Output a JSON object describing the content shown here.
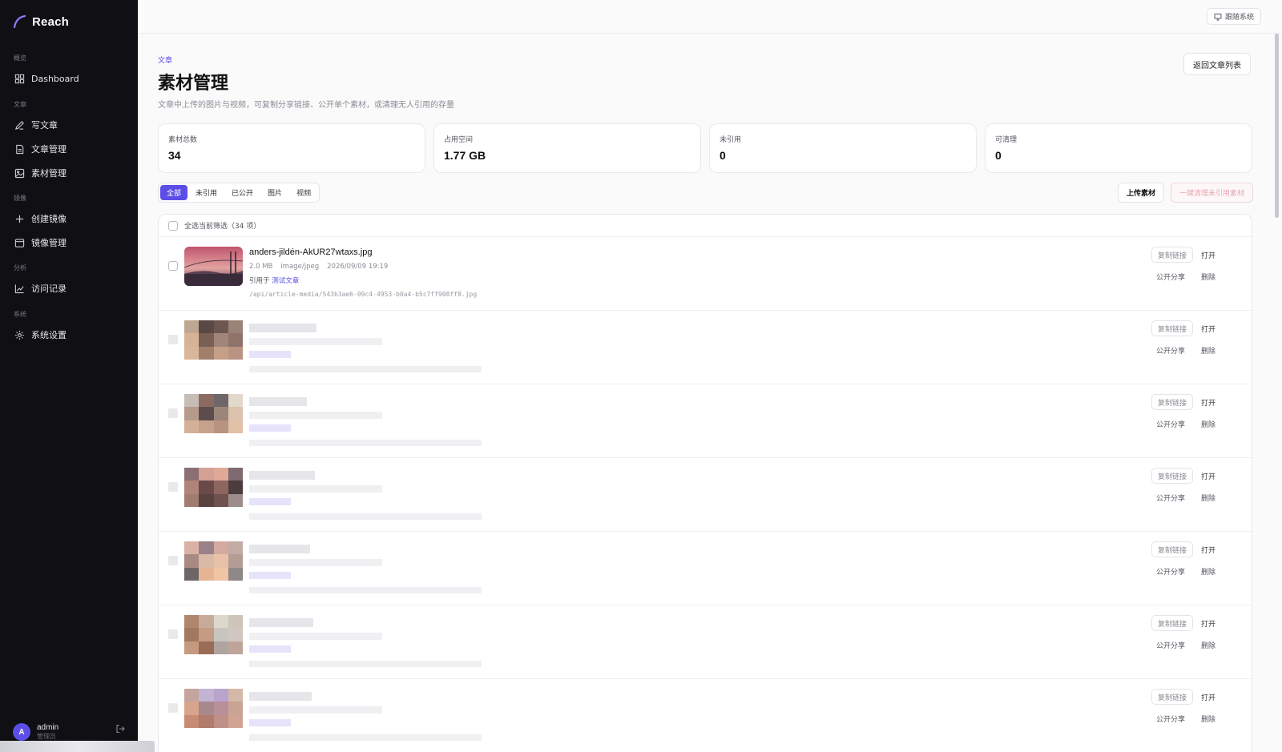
{
  "app": {
    "brand": "Reach"
  },
  "sidebar": {
    "groups": [
      {
        "label": "概览",
        "items": [
          {
            "label": "Dashboard",
            "icon": "grid-icon"
          }
        ]
      },
      {
        "label": "文章",
        "items": [
          {
            "label": "写文章",
            "icon": "pen-icon"
          },
          {
            "label": "文章管理",
            "icon": "document-icon"
          },
          {
            "label": "素材管理",
            "icon": "image-icon"
          }
        ]
      },
      {
        "label": "镜像",
        "items": [
          {
            "label": "创建镜像",
            "icon": "plus-icon"
          },
          {
            "label": "镜像管理",
            "icon": "window-icon"
          }
        ]
      },
      {
        "label": "分析",
        "items": [
          {
            "label": "访问记录",
            "icon": "line-chart-icon"
          }
        ]
      },
      {
        "label": "系统",
        "items": [
          {
            "label": "系统设置",
            "icon": "gear-icon"
          }
        ]
      }
    ],
    "user": {
      "initial": "A",
      "name": "admin",
      "role": "管理员"
    }
  },
  "topbar": {
    "follow_label": "跟随系统"
  },
  "header": {
    "crumb": "文章",
    "title": "素材管理",
    "subtitle": "文章中上传的图片与视频，可复制分享链接、公开单个素材，或清理无人引用的存量",
    "back_label": "返回文章列表"
  },
  "stats": [
    {
      "label": "素材总数",
      "value": "34"
    },
    {
      "label": "占用空间",
      "value": "1.77 GB"
    },
    {
      "label": "未引用",
      "value": "0"
    },
    {
      "label": "可清理",
      "value": "0"
    }
  ],
  "filters": [
    "全部",
    "未引用",
    "已公开",
    "图片",
    "视频"
  ],
  "toolbar": {
    "upload_label": "上传素材",
    "clean_label": "一键清理未引用素材"
  },
  "list": {
    "select_all_label": "全选当前筛选（34 项）",
    "first_item": {
      "name": "anders-jildén-AkUR27wtaxs.jpg",
      "size": "2.0 MB",
      "mime": "image/jpeg",
      "date": "2026/09/09 19:19",
      "ref_prefix": "引用于",
      "ref_link": "测试文章",
      "path": "/api/article-media/543b3ae6-09c4-4953-b0a4-b5c7ff908ff8.jpg"
    },
    "actions": {
      "copy": "复制链接",
      "open": "打开",
      "share": "公开分享",
      "delete": "删除"
    }
  },
  "colors": {
    "accent": "#5b4ee6",
    "sidebar_bg": "#0f0f14"
  }
}
